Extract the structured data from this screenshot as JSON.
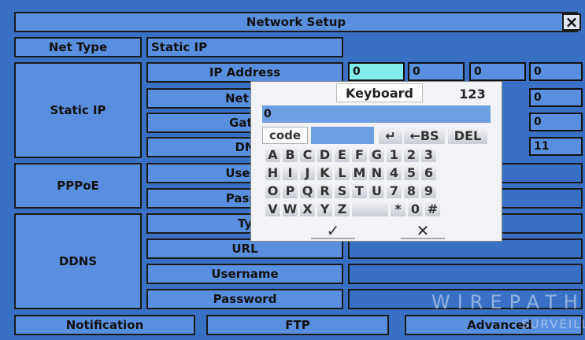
{
  "title": "Network Setup",
  "close_label": "×",
  "net_type": {
    "label": "Net Type",
    "value": "Static IP"
  },
  "static_ip": {
    "group_label": "Static IP",
    "fields": [
      {
        "label": "IP Address",
        "octets": [
          "0",
          "0",
          "0",
          "0"
        ]
      },
      {
        "label": "Net M",
        "octets": [
          "",
          "",
          "",
          "0"
        ]
      },
      {
        "label": "Gate",
        "octets": [
          "",
          "",
          "",
          "0"
        ]
      },
      {
        "label": "DN",
        "octets": [
          "",
          "",
          "",
          "11"
        ]
      }
    ]
  },
  "pppoe": {
    "group_label": "PPPoE",
    "fields": [
      "Usern",
      "Passv"
    ]
  },
  "ddns": {
    "group_label": "DDNS",
    "fields": [
      "Ty",
      "URL",
      "Username",
      "Password"
    ]
  },
  "bottom_tabs": [
    "Notification",
    "FTP",
    "Advanced"
  ],
  "keyboard": {
    "title": "Keyboard",
    "mode": "123",
    "input_value": "0",
    "code_label": "code",
    "enter_label": "↵",
    "backspace_label": "←BS",
    "delete_label": "DEL",
    "rows": [
      [
        "A",
        "B",
        "C",
        "D",
        "E",
        "F",
        "G",
        "1",
        "2",
        "3"
      ],
      [
        "H",
        "I",
        "J",
        "K",
        "L",
        "M",
        "N",
        "4",
        "5",
        "6"
      ],
      [
        "O",
        "P",
        "Q",
        "R",
        "S",
        "T",
        "U",
        "7",
        "8",
        "9"
      ],
      [
        "V",
        "W",
        "X",
        "Y",
        "Z",
        "",
        "*",
        "0",
        "#"
      ]
    ],
    "ok_label": "✓",
    "cancel_label": "✕"
  },
  "watermark": {
    "line1": "WIREPATH",
    "line2": "SURVEILLA"
  }
}
